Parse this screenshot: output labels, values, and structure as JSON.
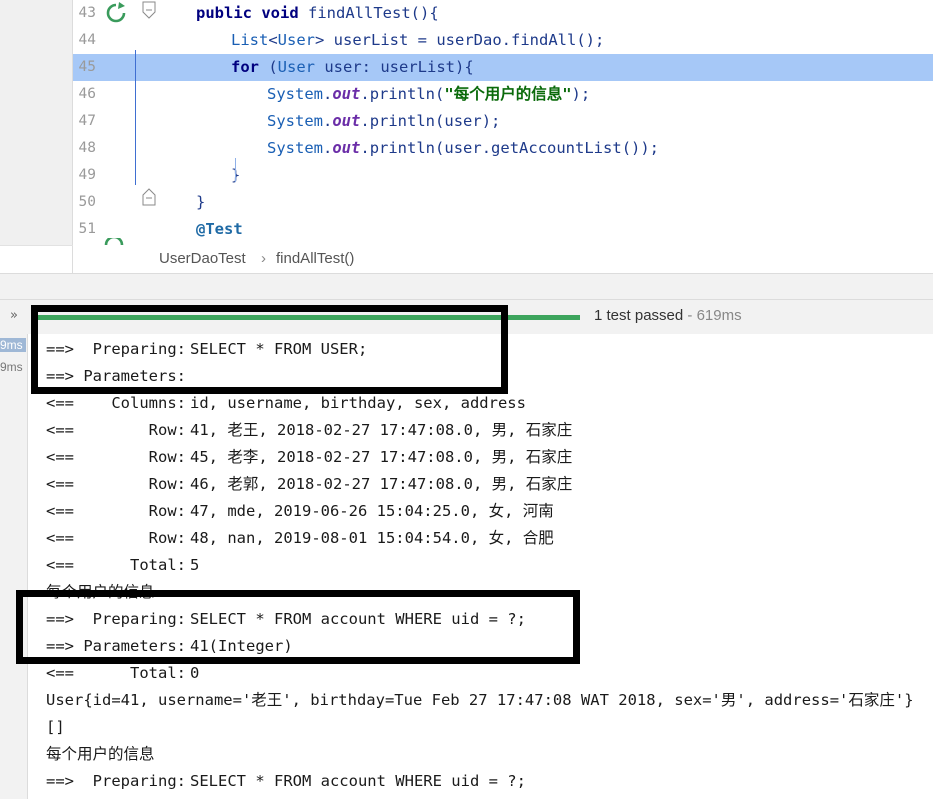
{
  "editor": {
    "lines": [
      {
        "num": "43",
        "parts": [
          [
            "kw",
            "public "
          ],
          [
            "kw",
            "void "
          ],
          [
            "var",
            "findAllTest"
          ],
          [
            "punc",
            "(){"
          ]
        ]
      },
      {
        "num": "44",
        "parts": [
          [
            "type",
            "List"
          ],
          [
            "punc",
            "<"
          ],
          [
            "type",
            "User"
          ],
          [
            "punc",
            "> "
          ],
          [
            "var",
            "userList"
          ],
          [
            "punc",
            " = "
          ],
          [
            "var",
            "userDao"
          ],
          [
            "punc",
            "."
          ],
          [
            "var",
            "findAll"
          ],
          [
            "punc",
            "();"
          ]
        ]
      },
      {
        "num": "45",
        "parts": [
          [
            "kw",
            "for "
          ],
          [
            "punc",
            "("
          ],
          [
            "type",
            "User "
          ],
          [
            "var",
            "user"
          ],
          [
            "punc",
            ": "
          ],
          [
            "var",
            "userList"
          ],
          [
            "punc",
            "){"
          ]
        ]
      },
      {
        "num": "46",
        "parts": [
          [
            "sys",
            "System"
          ],
          [
            "punc",
            "."
          ],
          [
            "field",
            "out"
          ],
          [
            "punc",
            "."
          ],
          [
            "var",
            "println"
          ],
          [
            "punc",
            "("
          ],
          [
            "str",
            "\"每个用户的信息\""
          ],
          [
            "punc",
            ");"
          ]
        ]
      },
      {
        "num": "47",
        "parts": [
          [
            "sys",
            "System"
          ],
          [
            "punc",
            "."
          ],
          [
            "field",
            "out"
          ],
          [
            "punc",
            "."
          ],
          [
            "var",
            "println"
          ],
          [
            "punc",
            "("
          ],
          [
            "var",
            "user"
          ],
          [
            "punc",
            ");"
          ]
        ]
      },
      {
        "num": "48",
        "parts": [
          [
            "sys",
            "System"
          ],
          [
            "punc",
            "."
          ],
          [
            "field",
            "out"
          ],
          [
            "punc",
            "."
          ],
          [
            "var",
            "println"
          ],
          [
            "punc",
            "("
          ],
          [
            "var",
            "user"
          ],
          [
            "punc",
            "."
          ],
          [
            "var",
            "getAccountList"
          ],
          [
            "punc",
            "());"
          ]
        ]
      },
      {
        "num": "49",
        "parts": [
          [
            "punc",
            "}"
          ]
        ]
      },
      {
        "num": "50",
        "parts": [
          [
            "punc",
            "}"
          ]
        ]
      },
      {
        "num": "51",
        "parts": [
          [
            "ann",
            "@Test"
          ]
        ]
      }
    ]
  },
  "breadcrumb": {
    "class_name": "UserDaoTest",
    "separator": "›",
    "method_name": "findAllTest()"
  },
  "run_panel": {
    "chevrons": "»",
    "status": "1 test passed",
    "time": "619ms",
    "tree_time_1": "9ms",
    "tree_time_2": "9ms"
  },
  "console": {
    "lines": [
      {
        "a": "==>  Preparing:",
        "b": "SELECT * FROM USER;"
      },
      {
        "a": "==> Parameters:",
        "b": ""
      },
      {
        "a": "<==    Columns:",
        "b": "id, username, birthday, sex, address"
      },
      {
        "a": "<==        Row:",
        "b": "41, 老王, 2018-02-27 17:47:08.0, 男, 石家庄"
      },
      {
        "a": "<==        Row:",
        "b": "45, 老李, 2018-02-27 17:47:08.0, 男, 石家庄"
      },
      {
        "a": "<==        Row:",
        "b": "46, 老郭, 2018-02-27 17:47:08.0, 男, 石家庄"
      },
      {
        "a": "<==        Row:",
        "b": "47, mde, 2019-06-26 15:04:25.0, 女, 河南"
      },
      {
        "a": "<==        Row:",
        "b": "48, nan, 2019-08-01 15:04:54.0, 女, 合肥"
      },
      {
        "a": "<==      Total:",
        "b": "5"
      },
      {
        "a": "每个用户的信息",
        "b": ""
      },
      {
        "a": "==>  Preparing:",
        "b": "SELECT * FROM account WHERE uid = ?;"
      },
      {
        "a": "==> Parameters:",
        "b": "41(Integer)"
      },
      {
        "a": "<==      Total:",
        "b": "0"
      },
      {
        "a": "User{id=41, username='老王', birthday=Tue Feb 27 17:47:08 WAT 2018, sex='男', address='石家庄'}",
        "b": ""
      },
      {
        "a": "[]",
        "b": ""
      },
      {
        "a": "每个用户的信息",
        "b": ""
      },
      {
        "a": "==>  Preparing:",
        "b": "SELECT * FROM account WHERE uid = ?;"
      }
    ]
  },
  "colors": {
    "highlight_line": "#a6c8f7",
    "progress": "#3da55d",
    "annotation_border": "#000000"
  }
}
